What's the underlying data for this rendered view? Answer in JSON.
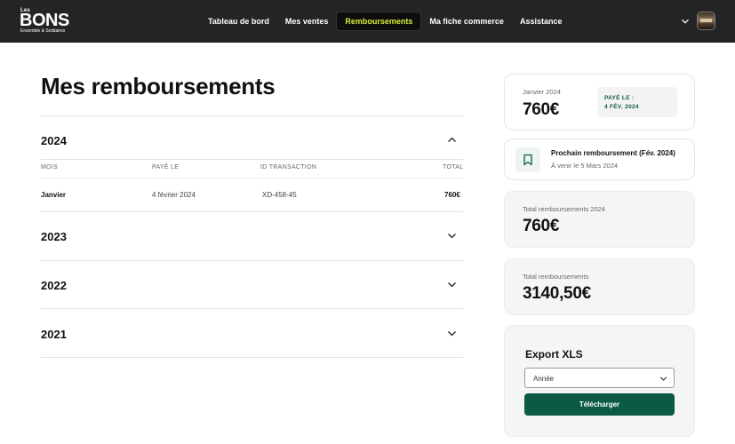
{
  "header": {
    "logo": {
      "small": "Les",
      "main": "BONS",
      "tagline": "Ensemble & Solidaires"
    },
    "nav": [
      {
        "label": "Tableau de bord"
      },
      {
        "label": "Mes ventes"
      },
      {
        "label": "Remboursements"
      },
      {
        "label": "Ma fiche commerce"
      },
      {
        "label": "Assistance"
      }
    ],
    "active_nav": "Remboursements",
    "accent_color": "#d9ec3a"
  },
  "main": {
    "title": "Mes remboursements",
    "years": [
      {
        "year": "2024",
        "expanded": true
      },
      {
        "year": "2023",
        "expanded": false
      },
      {
        "year": "2022",
        "expanded": false
      },
      {
        "year": "2021",
        "expanded": false
      }
    ],
    "table": {
      "columns": [
        "MOIS",
        "PAYÉ LE",
        "ID TRANSACTION",
        "TOTAL"
      ],
      "rows": [
        {
          "mois": "Janvier",
          "paye_le": "4 février 2024",
          "id": "XD-458-45",
          "total": "760€"
        }
      ]
    }
  },
  "sidebar": {
    "last_payment": {
      "label": "Janvier 2024",
      "amount": "760€",
      "paid_label": "PAYÉ LE :",
      "paid_date": "4 FÉV. 2024"
    },
    "next_payment": {
      "title": "Prochain remboursement (Fév. 2024)",
      "subtitle": "À venir le 5 Mars 2024"
    },
    "total_year": {
      "label": "Total remboursements 2024",
      "amount": "760€"
    },
    "total_all": {
      "label": "Total remboursements",
      "amount": "3140,50€"
    },
    "export": {
      "title": "Export XLS",
      "select_value": "Année",
      "button_label": "Télécharger"
    },
    "brand_color": "#0b5a43"
  }
}
